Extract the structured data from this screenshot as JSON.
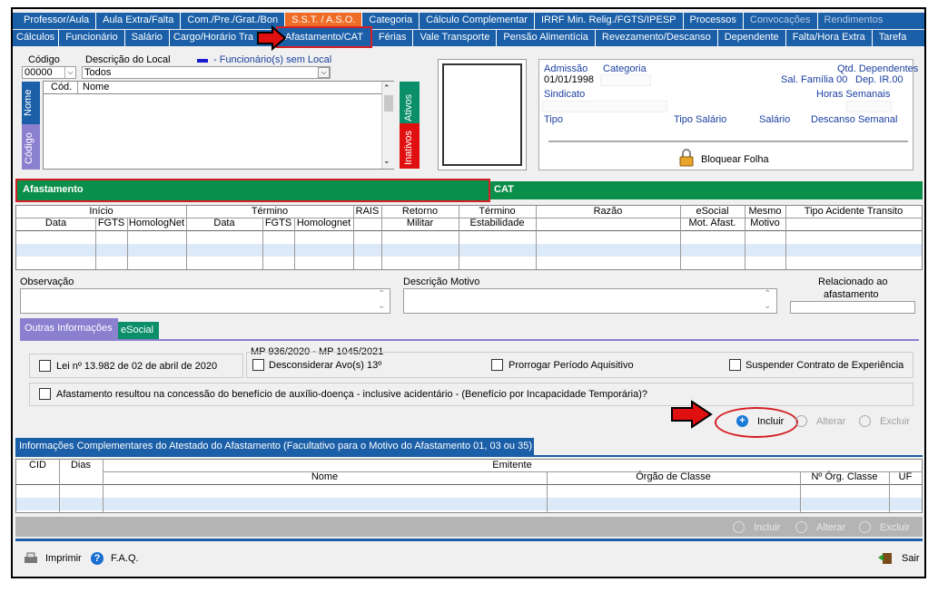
{
  "top_tabs": [
    "Professor/Aula",
    "Aula Extra/Falta",
    "Com./Pre./Grat./Bon",
    "S.S.T. / A.S.O.",
    "Categoria",
    "Cálculo Complementar",
    "IRRF Min. Relig./FGTS/IPESP",
    "Processos",
    "Convocações",
    "Rendimentos"
  ],
  "second_tabs": [
    "Cálculos",
    "Funcionário",
    "Salário",
    "Cargo/Horário Tra",
    "Afastamento/CAT",
    "Férias",
    "Vale Transporte",
    "Pensão Alimentícia",
    "Revezamento/Descanso",
    "Dependente",
    "Falta/Hora Extra",
    "Tarefa"
  ],
  "filter": {
    "codigo_label": "Código",
    "descricao_label": "Descrição do Local",
    "legend": "- Funcionário(s) sem Local",
    "codigo_value": "00000",
    "descricao_value": "Todos",
    "col_cod": "Cód.",
    "col_nome": "Nome",
    "side_nome": "Nome",
    "side_codigo": "Código",
    "side_ativos": "Ativos",
    "side_inativos": "Inativos"
  },
  "info": {
    "admissao_label": "Admissão",
    "admissao_value": "01/01/1998",
    "categoria_label": "Categoria",
    "qtd_dep_label": "Qtd. Dependentes",
    "sal_familia": "Sal. Família 00",
    "dep_ir": "Dep. IR.00",
    "sindicato_label": "Sindicato",
    "horas_label": "Horas Semanais",
    "tipo_label": "Tipo",
    "tipo_salario_label": "Tipo Salário",
    "salario_label": "Salário",
    "descanso_label": "Descanso Semanal",
    "bloquear": "Bloquear Folha"
  },
  "sections": {
    "afastamento": "Afastamento",
    "cat": "CAT"
  },
  "afast_grid": {
    "groups": [
      "Início",
      "Término",
      "RAIS",
      "Retorno",
      "Término",
      "Razão",
      "eSocial",
      "Mesmo",
      "Tipo Acidente Transito"
    ],
    "subs": [
      "Data",
      "FGTS",
      "HomologNet",
      "Data",
      "FGTS",
      "Homolognet",
      "Militar",
      "Estabilidade",
      "Mot. Afast.",
      "Motivo"
    ]
  },
  "obs": {
    "observacao": "Observação",
    "descricao_motivo": "Descrição Motivo",
    "relacionado": "Relacionado ao",
    "afastamento": "afastamento"
  },
  "subtabs": [
    "Outras Informações",
    "eSocial"
  ],
  "mp_title": "MP 936/2020 - MP 1045/2021",
  "checks": {
    "lei": "Lei nº 13.982 de 02 de abril de 2020",
    "desconsiderar": "Desconsiderar Avo(s) 13º",
    "prorrogar": "Prorrogar Período Aquisitivo",
    "suspender": "Suspender Contrato de Experiência",
    "auxilio": "Afastamento resultou na concessão do benefício de auxílio-doença - inclusive acidentário - (Benefício por Incapacidade Temporária)?"
  },
  "actions": {
    "incluir": "Incluir",
    "alterar": "Alterar",
    "excluir": "Excluir"
  },
  "atestado_tab": "Informações Complementares do Atestado do Afastamento (Facultativo para o Motivo do Afastamento 01, 03 ou 35)",
  "atestado_grid": {
    "cid": "CID",
    "dias": "Dias",
    "emitente": "Emitente",
    "nome": "Nome",
    "orgao": "Órgão de  Classe",
    "norgao": "Nº Órg. Classe",
    "uf": "UF"
  },
  "footer": {
    "imprimir": "Imprimir",
    "faq": "F.A.Q.",
    "sair": "Sair"
  }
}
